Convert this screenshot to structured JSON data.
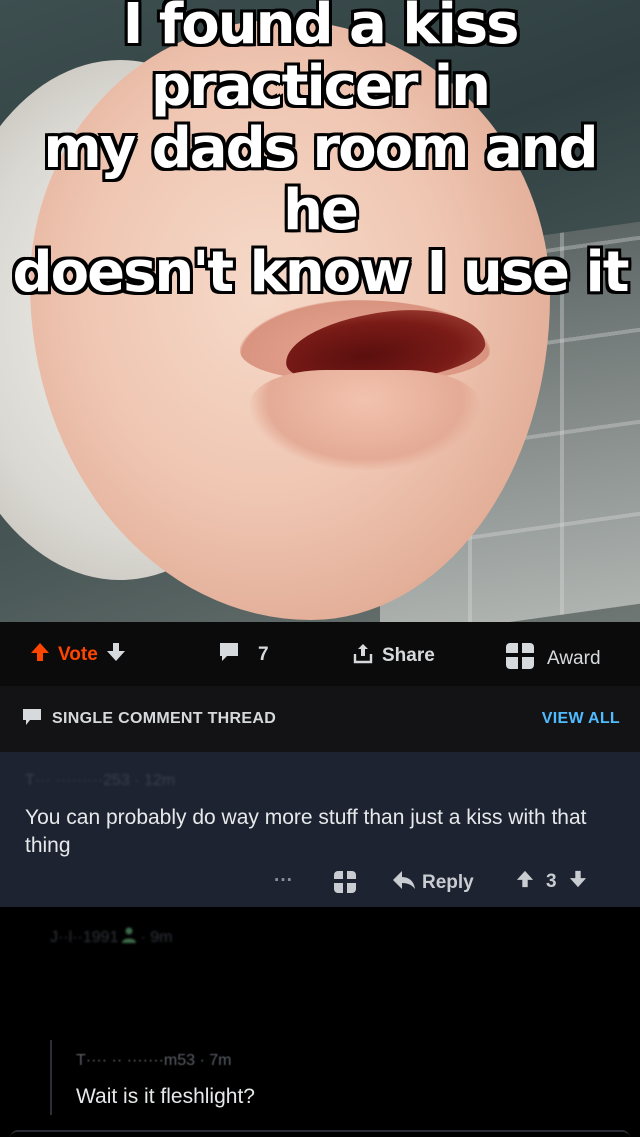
{
  "meme": {
    "caption_lines": [
      "I found a kiss practicer in",
      "my dads room and he",
      "doesn't know I use it"
    ]
  },
  "post_actions": {
    "vote_label": "Vote",
    "comment_count": "7",
    "share_label": "Share",
    "award_label": "Award"
  },
  "thread": {
    "title": "SINGLE COMMENT THREAD",
    "view_all": "VIEW ALL"
  },
  "comment": {
    "meta": "T··· ·········253 · 12m",
    "body": "You can probably do way more stuff than just a kiss with that thing",
    "more_label": "···",
    "reply_label": "Reply",
    "score": "3"
  },
  "reply1": {
    "meta": "J··l··1991",
    "time": "· 9m"
  },
  "reply2": {
    "meta": "T···· ·· ·······m53 · 7m",
    "body": "Wait is it fleshlight?"
  },
  "colors": {
    "upvote": "#ff4500",
    "link": "#4fbcff",
    "highlight_bg": "#1d2330"
  }
}
